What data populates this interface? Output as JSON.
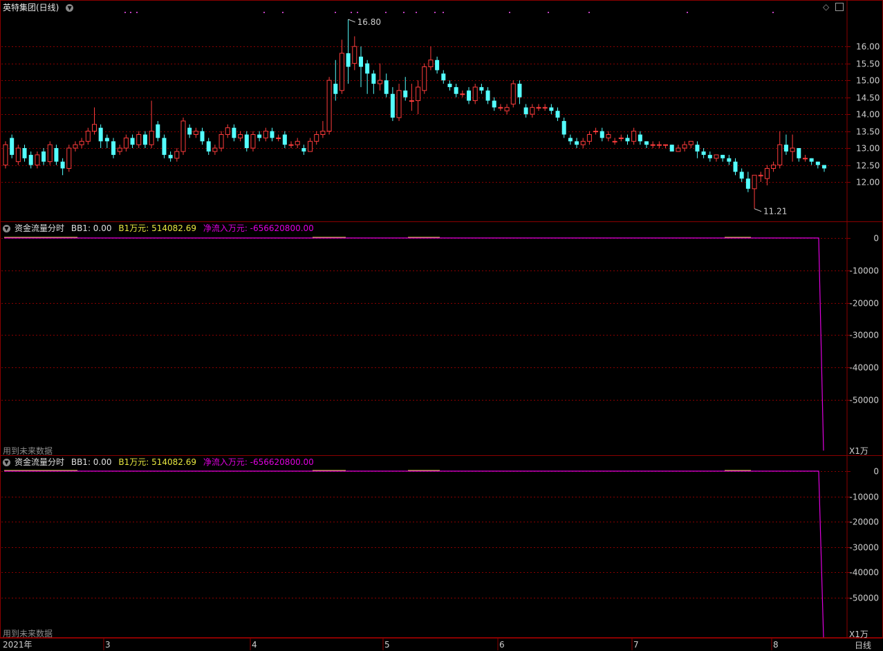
{
  "header": {
    "stock_title": "英特集团(日线)",
    "indicator_title": "资金流量分时",
    "bb1_label": "BB1: 0.00",
    "b1_label": "B1万元: 514082.69",
    "net_inflow_label": "净流入万元: -656620800.00"
  },
  "footer": {
    "future_data_note": "用到未来数据"
  },
  "unit_label": "X1万",
  "period_label": "日线",
  "annotations": {
    "high": "16.80",
    "low": "11.21"
  },
  "dates": [
    "2021年",
    "3",
    "4",
    "5",
    "6",
    "7",
    "8"
  ],
  "colors": {
    "up": "#ff3c3c",
    "down": "#54ffff",
    "line": "#e000e0",
    "grid": "#8b0000",
    "b1": "#e8e840"
  },
  "chart_data": [
    {
      "type": "candlestick",
      "title": "英特集团(日线)",
      "y_ticks": [
        "12.00",
        "12.50",
        "13.00",
        "13.50",
        "14.00",
        "14.50",
        "15.00",
        "15.50",
        "16.00"
      ],
      "ylim": [
        11.0,
        16.8
      ],
      "high": 16.8,
      "low": 11.21,
      "candles": [
        [
          12.5,
          13.1,
          12.4,
          13.2
        ],
        [
          13.3,
          12.8,
          12.7,
          13.4
        ],
        [
          12.6,
          13.0,
          12.5,
          13.1
        ],
        [
          13.0,
          12.7,
          12.6,
          13.1
        ],
        [
          12.8,
          12.5,
          12.4,
          12.9
        ],
        [
          12.5,
          12.8,
          12.4,
          12.9
        ],
        [
          12.9,
          12.6,
          12.5,
          13.0
        ],
        [
          12.6,
          13.1,
          12.5,
          13.2
        ],
        [
          13.0,
          12.6,
          12.5,
          13.1
        ],
        [
          12.6,
          12.4,
          12.2,
          12.7
        ],
        [
          12.4,
          13.0,
          12.3,
          13.1
        ],
        [
          13.0,
          13.1,
          12.9,
          13.2
        ],
        [
          13.1,
          13.2,
          13.0,
          13.3
        ],
        [
          13.2,
          13.5,
          13.1,
          13.6
        ],
        [
          13.5,
          13.7,
          13.4,
          14.2
        ],
        [
          13.6,
          13.2,
          13.0,
          13.7
        ],
        [
          13.3,
          13.2,
          13.0,
          13.4
        ],
        [
          13.2,
          12.8,
          12.7,
          13.3
        ],
        [
          12.9,
          13.0,
          12.8,
          13.1
        ],
        [
          13.0,
          13.3,
          12.9,
          13.4
        ],
        [
          13.3,
          13.1,
          13.0,
          13.4
        ],
        [
          13.1,
          13.4,
          13.0,
          13.5
        ],
        [
          13.4,
          13.1,
          13.0,
          13.5
        ],
        [
          13.1,
          13.5,
          13.0,
          14.4
        ],
        [
          13.7,
          13.3,
          13.2,
          13.8
        ],
        [
          13.3,
          12.8,
          12.7,
          13.4
        ],
        [
          12.8,
          12.7,
          12.6,
          12.9
        ],
        [
          12.7,
          12.9,
          12.6,
          13.0
        ],
        [
          12.9,
          13.8,
          12.8,
          13.9
        ],
        [
          13.6,
          13.4,
          13.3,
          13.7
        ],
        [
          13.4,
          13.5,
          13.3,
          13.6
        ],
        [
          13.5,
          13.2,
          13.1,
          13.6
        ],
        [
          13.2,
          12.9,
          12.8,
          13.3
        ],
        [
          12.9,
          13.0,
          12.8,
          13.1
        ],
        [
          13.0,
          13.4,
          12.9,
          13.5
        ],
        [
          13.4,
          13.6,
          13.3,
          13.7
        ],
        [
          13.6,
          13.3,
          13.2,
          13.7
        ],
        [
          13.3,
          13.4,
          13.2,
          13.5
        ],
        [
          13.4,
          13.0,
          12.9,
          13.5
        ],
        [
          13.0,
          13.4,
          12.9,
          13.5
        ],
        [
          13.4,
          13.3,
          13.2,
          13.5
        ],
        [
          13.3,
          13.5,
          13.2,
          13.6
        ],
        [
          13.5,
          13.3,
          13.2,
          13.6
        ],
        [
          13.3,
          13.3,
          13.2,
          13.4
        ],
        [
          13.4,
          13.1,
          13.0,
          13.5
        ],
        [
          13.1,
          13.1,
          13.0,
          13.2
        ],
        [
          13.1,
          13.2,
          13.0,
          13.3
        ],
        [
          13.0,
          12.9,
          12.8,
          13.1
        ],
        [
          12.9,
          13.2,
          12.9,
          13.3
        ],
        [
          13.2,
          13.4,
          13.1,
          13.5
        ],
        [
          13.4,
          13.5,
          13.3,
          13.8
        ],
        [
          13.5,
          15.0,
          13.4,
          15.1
        ],
        [
          14.9,
          14.6,
          14.4,
          15.6
        ],
        [
          14.7,
          15.8,
          14.6,
          16.2
        ],
        [
          15.8,
          15.4,
          14.9,
          16.8
        ],
        [
          15.5,
          16.0,
          15.3,
          16.3
        ],
        [
          15.7,
          15.4,
          14.8,
          16.0
        ],
        [
          15.5,
          15.2,
          14.6,
          15.6
        ],
        [
          15.2,
          14.9,
          14.6,
          15.3
        ],
        [
          14.9,
          15.0,
          14.7,
          15.5
        ],
        [
          15.0,
          14.6,
          14.5,
          15.2
        ],
        [
          14.6,
          13.9,
          13.8,
          14.8
        ],
        [
          13.9,
          14.7,
          13.8,
          14.9
        ],
        [
          14.7,
          14.5,
          14.4,
          15.1
        ],
        [
          14.4,
          14.4,
          14.1,
          14.9
        ],
        [
          14.4,
          14.8,
          14.0,
          15.0
        ],
        [
          14.7,
          15.4,
          14.6,
          15.5
        ],
        [
          15.4,
          15.6,
          15.3,
          16.0
        ],
        [
          15.6,
          15.3,
          15.2,
          15.7
        ],
        [
          15.2,
          15.0,
          14.9,
          15.3
        ],
        [
          14.9,
          14.8,
          14.7,
          15.0
        ],
        [
          14.8,
          14.6,
          14.5,
          14.9
        ],
        [
          14.6,
          14.6,
          14.5,
          14.7
        ],
        [
          14.7,
          14.4,
          14.3,
          14.8
        ],
        [
          14.4,
          14.8,
          14.3,
          14.9
        ],
        [
          14.8,
          14.7,
          14.6,
          14.9
        ],
        [
          14.7,
          14.4,
          14.3,
          14.8
        ],
        [
          14.4,
          14.2,
          14.1,
          14.5
        ],
        [
          14.2,
          14.2,
          14.1,
          14.3
        ],
        [
          14.1,
          14.2,
          14.0,
          14.3
        ],
        [
          14.3,
          14.9,
          14.2,
          15.0
        ],
        [
          14.9,
          14.5,
          14.3,
          15.0
        ],
        [
          14.2,
          14.0,
          13.9,
          14.3
        ],
        [
          14.0,
          14.2,
          13.9,
          14.3
        ],
        [
          14.2,
          14.2,
          14.1,
          14.3
        ],
        [
          14.2,
          14.2,
          14.1,
          14.3
        ],
        [
          14.2,
          14.1,
          14.0,
          14.3
        ],
        [
          14.1,
          13.9,
          13.8,
          14.2
        ],
        [
          13.8,
          13.4,
          13.3,
          13.9
        ],
        [
          13.3,
          13.2,
          13.1,
          13.4
        ],
        [
          13.2,
          13.1,
          13.0,
          13.3
        ],
        [
          13.1,
          13.2,
          13.0,
          13.3
        ],
        [
          13.2,
          13.4,
          13.1,
          13.5
        ],
        [
          13.5,
          13.5,
          13.4,
          13.6
        ],
        [
          13.5,
          13.3,
          13.2,
          13.6
        ],
        [
          13.3,
          13.4,
          13.2,
          13.5
        ],
        [
          13.2,
          13.2,
          13.1,
          13.3
        ],
        [
          13.3,
          13.3,
          13.2,
          13.4
        ],
        [
          13.3,
          13.2,
          13.1,
          13.4
        ],
        [
          13.2,
          13.5,
          13.1,
          13.6
        ],
        [
          13.4,
          13.2,
          13.1,
          13.5
        ],
        [
          13.2,
          13.1,
          13.0,
          13.2
        ],
        [
          13.1,
          13.1,
          13.0,
          13.2
        ],
        [
          13.1,
          13.1,
          13.0,
          13.2
        ],
        [
          13.1,
          13.1,
          13.0,
          13.1
        ],
        [
          13.1,
          12.9,
          12.9,
          13.1
        ],
        [
          12.9,
          13.0,
          12.9,
          13.1
        ],
        [
          13.0,
          13.1,
          12.9,
          13.2
        ],
        [
          13.1,
          13.2,
          13.0,
          13.2
        ],
        [
          13.1,
          12.9,
          12.7,
          13.2
        ],
        [
          12.9,
          12.8,
          12.7,
          13.0
        ],
        [
          12.8,
          12.7,
          12.6,
          12.9
        ],
        [
          12.7,
          12.8,
          12.6,
          12.8
        ],
        [
          12.8,
          12.7,
          12.6,
          12.8
        ],
        [
          12.7,
          12.6,
          12.5,
          12.8
        ],
        [
          12.6,
          12.3,
          12.2,
          12.7
        ],
        [
          12.3,
          12.1,
          12.0,
          12.4
        ],
        [
          12.1,
          11.8,
          11.7,
          12.3
        ],
        [
          11.8,
          12.2,
          11.21,
          12.2
        ],
        [
          12.2,
          12.2,
          12.0,
          12.3
        ],
        [
          12.1,
          12.4,
          11.9,
          12.5
        ],
        [
          12.4,
          12.5,
          12.3,
          12.6
        ],
        [
          12.5,
          13.1,
          12.4,
          13.5
        ],
        [
          13.1,
          12.9,
          12.8,
          13.4
        ],
        [
          12.9,
          13.0,
          12.6,
          13.4
        ],
        [
          13.0,
          12.7,
          12.6,
          13.0
        ],
        [
          12.7,
          12.7,
          12.6,
          12.8
        ],
        [
          12.7,
          12.6,
          12.5,
          12.7
        ],
        [
          12.6,
          12.5,
          12.4,
          12.6
        ],
        [
          12.5,
          12.4,
          12.3,
          12.5
        ]
      ]
    },
    {
      "type": "line",
      "title": "资金流量分时",
      "y_ticks": [
        "0",
        "-10000",
        "-20000",
        "-30000",
        "-40000",
        "-50000"
      ],
      "ylim": [
        -67500,
        500
      ],
      "series": [
        {
          "name": "净流入万元",
          "values": [
            0,
            0,
            0,
            0,
            0,
            0,
            0,
            0,
            0,
            0,
            -65662
          ]
        }
      ]
    },
    {
      "type": "line",
      "title": "资金流量分时",
      "y_ticks": [
        "0",
        "-10000",
        "-20000",
        "-30000",
        "-40000",
        "-50000"
      ],
      "ylim": [
        -64000,
        500
      ],
      "series": [
        {
          "name": "净流入万元",
          "values": [
            0,
            0,
            0,
            0,
            0,
            0,
            0,
            0,
            0,
            0,
            -65662
          ]
        }
      ]
    }
  ]
}
